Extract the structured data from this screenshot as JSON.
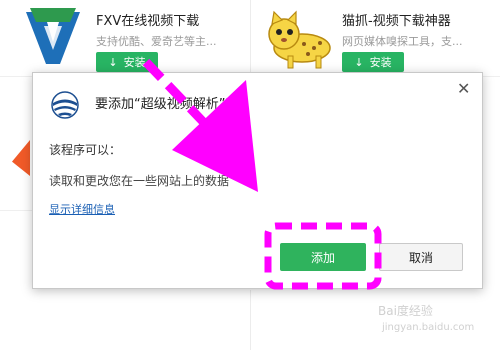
{
  "store": {
    "apps": [
      {
        "name": "FXV在线视频下载",
        "desc": "支持优酷、爱奇艺等主...",
        "install_label": "安装",
        "logo_icon": "fxv-shield-v-logo"
      },
      {
        "name": "猫抓-视频下载神器",
        "desc": "网页媒体嗅探工具，支...",
        "install_label": "安装",
        "logo_icon": "cheetah-cat-logo"
      }
    ]
  },
  "dialog": {
    "title": "要添加“超级视频解析”吗？",
    "perm_heading": "该程序可以：",
    "perm_item": "读取和更改您在一些网站上的数据",
    "details_link": "显示详细信息",
    "add_label": "添加",
    "cancel_label": "取消",
    "close_icon": "close-icon",
    "logo_icon": "globe-extension-logo"
  },
  "watermark": {
    "text": "Bai度经验",
    "url": "jingyan.baidu.com"
  },
  "colors": {
    "install_green": "#28b463",
    "add_green": "#2fb35d",
    "annotation_magenta": "#ff00ff",
    "link_blue": "#1a5fb4"
  }
}
